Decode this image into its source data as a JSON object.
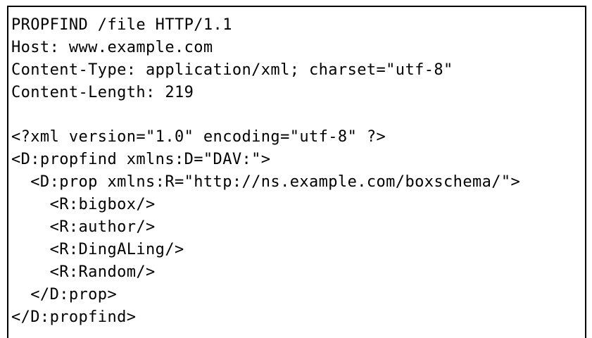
{
  "request": {
    "headers": [
      "PROPFIND /file HTTP/1.1",
      "Host: www.example.com",
      "Content-Type: application/xml; charset=\"utf-8\"",
      "Content-Length: 219"
    ],
    "body": [
      "<?xml version=\"1.0\" encoding=\"utf-8\" ?>",
      "<D:propfind xmlns:D=\"DAV:\">",
      "  <D:prop xmlns:R=\"http://ns.example.com/boxschema/\">",
      "    <R:bigbox/>",
      "    <R:author/>",
      "    <R:DingALing/>",
      "    <R:Random/>",
      "  </D:prop>",
      "</D:propfind>"
    ]
  }
}
